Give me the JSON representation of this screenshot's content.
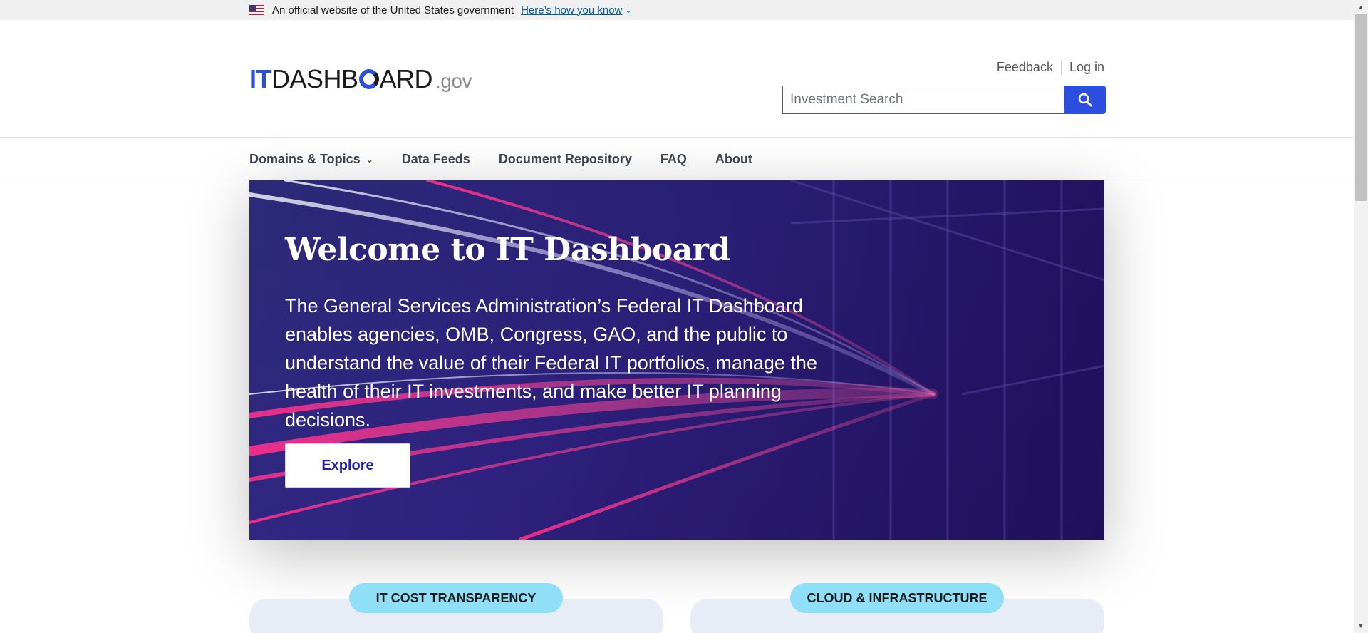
{
  "gov_banner": {
    "text": "An official website of the United States government",
    "link": "Here’s how you know",
    "flag_icon": "us-flag-icon",
    "chevron_icon": "chevron-down-icon"
  },
  "header": {
    "logo": {
      "it": "IT",
      "dash": "DASHB",
      "ard": "ARD",
      "gov": ".gov"
    },
    "utility": {
      "feedback": "Feedback",
      "login": "Log in"
    },
    "search": {
      "placeholder": "Investment Search",
      "value": "",
      "button_icon": "search-icon"
    }
  },
  "nav": {
    "items": [
      {
        "label": "Domains & Topics",
        "has_dropdown": true
      },
      {
        "label": "Data Feeds"
      },
      {
        "label": "Document Repository"
      },
      {
        "label": "FAQ"
      },
      {
        "label": "About"
      }
    ]
  },
  "hero": {
    "title": "Welcome to IT Dashboard",
    "text": "The General Services Administration’s Federal IT Dashboard enables agencies, OMB, Congress, GAO, and the public to understand the value of their Federal IT portfolios, manage the health of their IT investments, and make better IT planning decisions.",
    "button": "Explore"
  },
  "cards": [
    {
      "label": "IT COST TRANSPARENCY"
    },
    {
      "label": "CLOUD & INFRASTRUCTURE"
    }
  ],
  "colors": {
    "brand_blue": "#2d4fe0",
    "hero_purple": "#2c2a78",
    "pill_cyan": "#8fdff8",
    "link_blue": "#005ea2"
  }
}
